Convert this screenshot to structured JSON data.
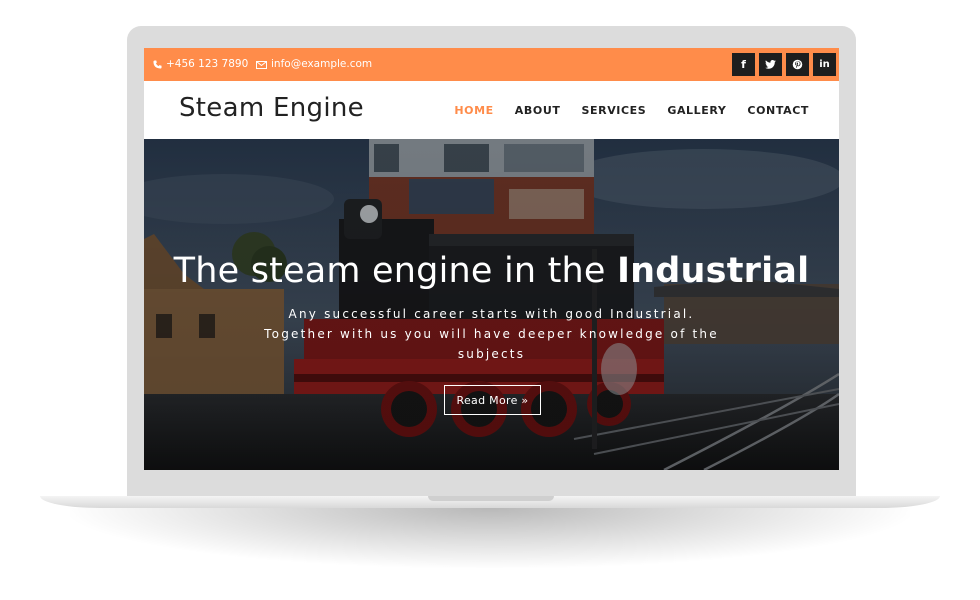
{
  "topbar": {
    "phone": "+456 123 7890",
    "email": "info@example.com",
    "bg_color": "#ff8c4a",
    "social": [
      {
        "icon": "facebook-icon",
        "glyph": "f"
      },
      {
        "icon": "twitter-icon",
        "glyph": "t"
      },
      {
        "icon": "pinterest-icon",
        "glyph": "p"
      },
      {
        "icon": "linkedin-icon",
        "glyph": "in"
      }
    ]
  },
  "header": {
    "logo": "Steam Engine",
    "nav": [
      {
        "label": "HOME",
        "active": true
      },
      {
        "label": "ABOUT",
        "active": false
      },
      {
        "label": "SERVICES",
        "active": false
      },
      {
        "label": "GALLERY",
        "active": false
      },
      {
        "label": "CONTACT",
        "active": false
      }
    ],
    "accent_color": "#ff8c4a"
  },
  "hero": {
    "title_regular": "The steam engine in the ",
    "title_bold": "Industrial",
    "subtitle": "Any successful career starts with good Industrial. Together with us you will have deeper knowledge of the subjects",
    "button_label": "Read More »"
  }
}
